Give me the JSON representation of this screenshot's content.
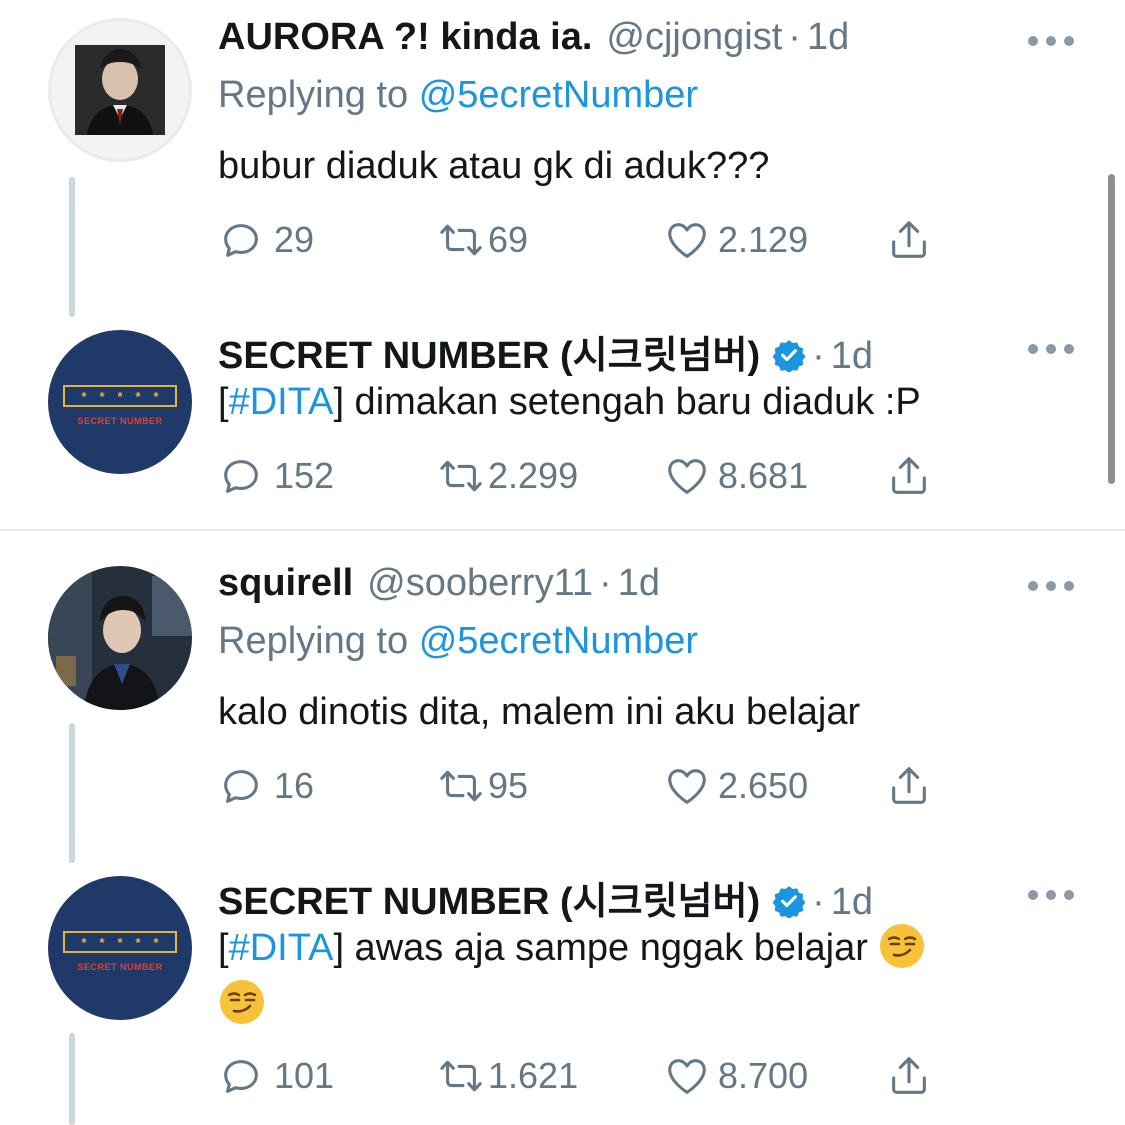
{
  "tweets": [
    {
      "display_name": "AURORA ?! kinda ia.",
      "handle": "@cjjongist",
      "dot": "·",
      "time": "1d",
      "replying_prefix": "Replying to",
      "replying_to": "@5ecretNumber",
      "text": "bubur diaduk atau gk di aduk???",
      "replies": "29",
      "retweets": "69",
      "likes": "2.129"
    },
    {
      "display_name": "SECRET NUMBER (시크릿넘버)",
      "dot": "·",
      "time": "1d",
      "hashtag_open": "[",
      "hashtag": "#DITA",
      "hashtag_close": "]",
      "text": " dimakan setengah baru diaduk :P",
      "replies": "152",
      "retweets": "2.299",
      "likes": "8.681",
      "logo_stars": [
        "*",
        "*",
        "*",
        "*",
        "*"
      ],
      "logo_text": "SECRET NUMBER"
    },
    {
      "display_name": "squirell",
      "handle": "@sooberry11",
      "dot": "·",
      "time": "1d",
      "replying_prefix": "Replying to",
      "replying_to": "@5ecretNumber",
      "text": "kalo dinotis dita, malem ini aku belajar",
      "replies": "16",
      "retweets": "95",
      "likes": "2.650"
    },
    {
      "display_name": "SECRET NUMBER (시크릿넘버)",
      "dot": "·",
      "time": "1d",
      "hashtag_open": "[",
      "hashtag": "#DITA",
      "hashtag_close": "]",
      "text": " awas aja sampe nggak belajar",
      "replies": "101",
      "retweets": "1.621",
      "likes": "8.700",
      "logo_stars": [
        "*",
        "*",
        "*",
        "*",
        "*"
      ],
      "logo_text": "SECRET NUMBER"
    }
  ],
  "icons": {
    "reply": "reply-icon",
    "retweet": "retweet-icon",
    "like": "heart-icon",
    "share": "share-icon",
    "more": "more-icon",
    "verified": "verified-badge-icon",
    "emoji": "smirking-face-emoji"
  },
  "colors": {
    "link": "#1b95e0",
    "secondary_text": "#657786",
    "thread_line": "#ccd6dd",
    "brand_navy": "#1f3a68",
    "brand_gold": "#e3b53a"
  }
}
